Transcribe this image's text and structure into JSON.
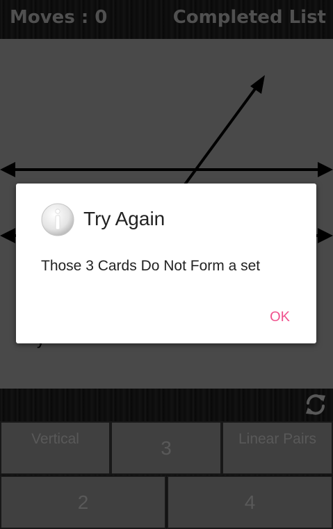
{
  "header": {
    "moves_label": "Moves : 0",
    "completed_label": "Completed List"
  },
  "card": {
    "partial_text": "y"
  },
  "toolbar": {
    "refresh_icon": "refresh-icon"
  },
  "answer_grid": {
    "row1": [
      "Vertical",
      "3",
      "Linear Pairs"
    ],
    "row2": [
      "2",
      "4"
    ]
  },
  "dialog": {
    "icon": "info-icon",
    "title": "Try Again",
    "message": "Those 3 Cards Do Not Form a set",
    "ok_label": "OK"
  },
  "colors": {
    "accent": "#f0528e",
    "card_background": "#7f7f7f"
  }
}
